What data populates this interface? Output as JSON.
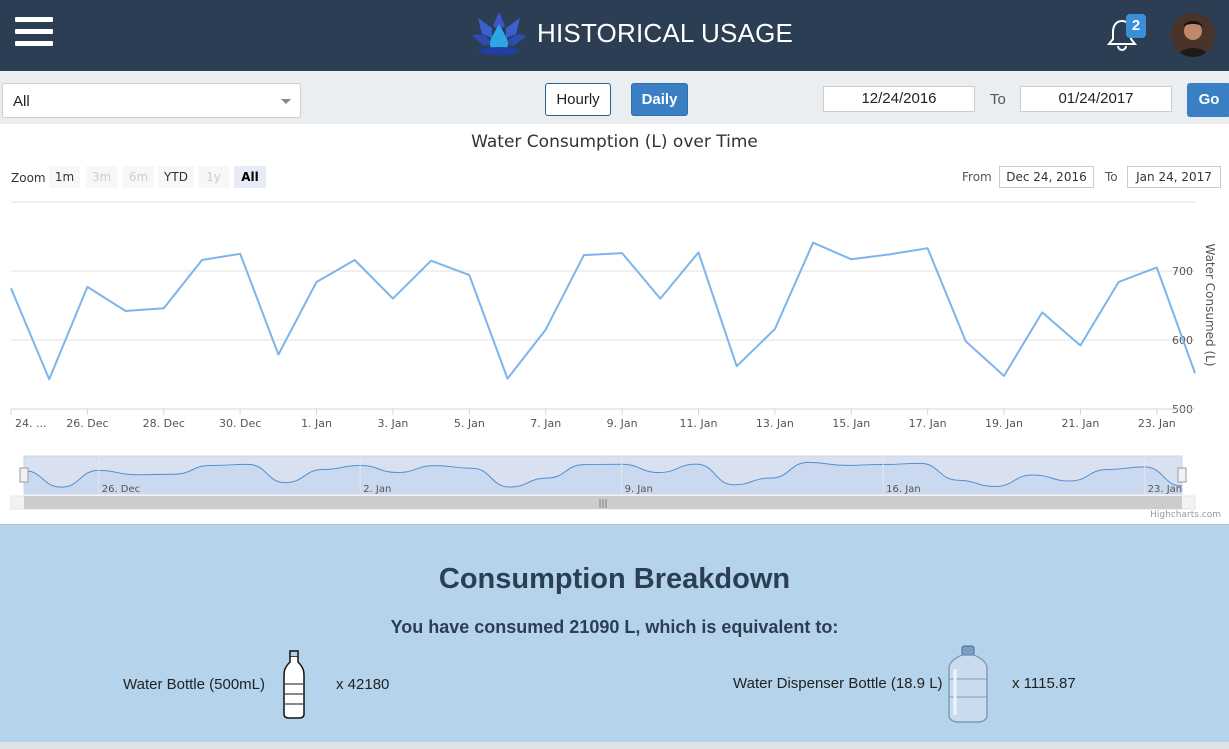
{
  "header": {
    "title": "HISTORICAL USAGE",
    "notification_count": "2"
  },
  "controls": {
    "device_select": "All",
    "hourly_label": "Hourly",
    "daily_label": "Daily",
    "start_date": "12/24/2016",
    "to_label": "To",
    "end_date": "01/24/2017",
    "go_label": "Go"
  },
  "chart": {
    "zoom_label": "Zoom",
    "zoom_buttons": [
      "1m",
      "3m",
      "6m",
      "YTD",
      "1y",
      "All"
    ],
    "range_from_label": "From",
    "range_from": "Dec 24, 2016",
    "range_to_label": "To",
    "range_to": "Jan 24, 2017",
    "credits": "Highcharts.com",
    "navigator_labels": [
      "26. Dec",
      "2. Jan",
      "9. Jan",
      "16. Jan",
      "23. Jan"
    ]
  },
  "chart_data": {
    "type": "line",
    "title": "Water Consumption (L) over Time",
    "ylabel": "Water Consumed (L)",
    "xlabel": "",
    "ylim": [
      500,
      800
    ],
    "yticks": [
      500,
      600,
      700
    ],
    "x_tick_labels": [
      "24. ...",
      "26. Dec",
      "28. Dec",
      "30. Dec",
      "1. Jan",
      "3. Jan",
      "5. Jan",
      "7. Jan",
      "9. Jan",
      "11. Jan",
      "13. Jan",
      "15. Jan",
      "17. Jan",
      "19. Jan",
      "21. Jan",
      "23. Jan"
    ],
    "x": [
      "Dec 24",
      "Dec 25",
      "Dec 26",
      "Dec 27",
      "Dec 28",
      "Dec 29",
      "Dec 30",
      "Dec 31",
      "Jan 1",
      "Jan 2",
      "Jan 3",
      "Jan 4",
      "Jan 5",
      "Jan 6",
      "Jan 7",
      "Jan 8",
      "Jan 9",
      "Jan 10",
      "Jan 11",
      "Jan 12",
      "Jan 13",
      "Jan 14",
      "Jan 15",
      "Jan 16",
      "Jan 17",
      "Jan 18",
      "Jan 19",
      "Jan 20",
      "Jan 21",
      "Jan 22",
      "Jan 23",
      "Jan 24"
    ],
    "values": [
      675,
      543,
      677,
      642,
      646,
      716,
      725,
      579,
      684,
      716,
      660,
      715,
      694,
      544,
      615,
      723,
      726,
      660,
      727,
      562,
      616,
      741,
      717,
      724,
      733,
      598,
      548,
      640,
      592,
      684,
      705,
      552
    ],
    "grid": true,
    "legend": "none"
  },
  "breakdown": {
    "title": "Consumption Breakdown",
    "subtitle": "You have consumed 21090 L, which is equivalent to:",
    "items": [
      {
        "label": "Water Bottle (500mL)",
        "value": "x 42180"
      },
      {
        "label": "Water Dispenser Bottle (18.9 L)",
        "value": "x 1115.87"
      }
    ]
  },
  "colors": {
    "header_bg": "#2b3e54",
    "accent": "#3a7fc4",
    "line": "#7cb5ec",
    "breakdown_bg": "#b5d4eb"
  }
}
